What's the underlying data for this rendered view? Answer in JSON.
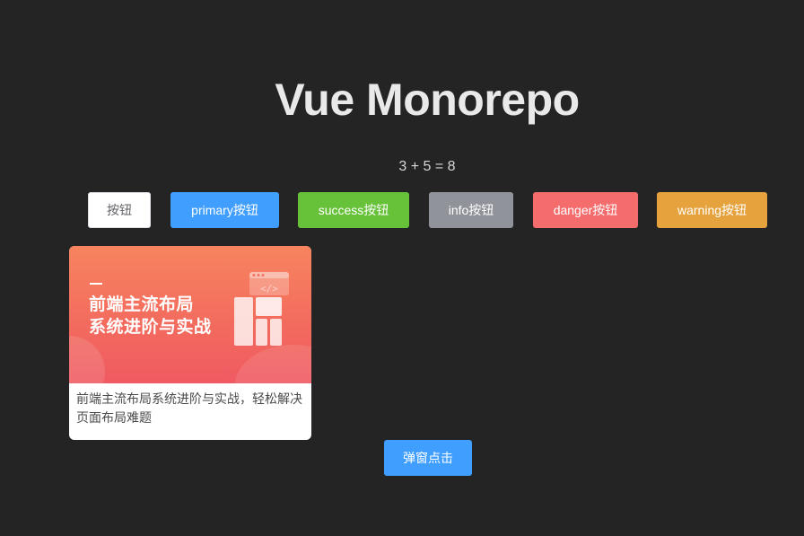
{
  "header": {
    "title": "Vue Monorepo",
    "equation": "3 + 5 = 8"
  },
  "buttons": {
    "default_label": "按钮",
    "primary_label": "primary按钮",
    "success_label": "success按钮",
    "info_label": "info按钮",
    "danger_label": "danger按钮",
    "warning_label": "warning按钮"
  },
  "card": {
    "cover_line1": "前端主流布局",
    "cover_line2": "系统进阶与实战",
    "cover_icon": "code-window-layout-icon",
    "description": "前端主流布局系统进阶与实战，轻松解决页面布局难题"
  },
  "popup": {
    "button_label": "弹窗点击"
  },
  "colors": {
    "background": "#242424",
    "primary": "#409eff",
    "success": "#67c23a",
    "info": "#909399",
    "danger": "#f56c6c",
    "warning": "#e6a23c"
  }
}
